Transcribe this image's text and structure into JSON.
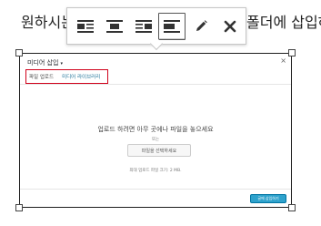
{
  "paragraph": {
    "text_left": "원하시는",
    "text_right": "폴더에 삽입하"
  },
  "toolbar": {
    "buttons": [
      {
        "name": "align-left",
        "label": "Align left"
      },
      {
        "name": "align-center",
        "label": "Align center"
      },
      {
        "name": "align-right",
        "label": "Align right"
      },
      {
        "name": "align-none",
        "label": "No alignment",
        "active": true
      },
      {
        "name": "edit",
        "label": "Edit"
      },
      {
        "name": "remove",
        "label": "Remove"
      }
    ]
  },
  "modal": {
    "title": "미디어 삽입",
    "title_caret": "▾",
    "close": "×",
    "tabs": [
      "파일 업로드",
      "미디어 라이브러리"
    ],
    "drop_title": "업로드 하려면 아무 곳에나 파일을 놓으세요",
    "or": "또는",
    "select_files": "파일을 선택하세요",
    "max_size": "최대 업로드 파일 크기: 2 MB.",
    "insert_button": "글에 삽입하기"
  },
  "colors": {
    "tab_highlight_border": "#d0021b",
    "primary_button": "#2ea2cc",
    "link": "#21759b"
  }
}
